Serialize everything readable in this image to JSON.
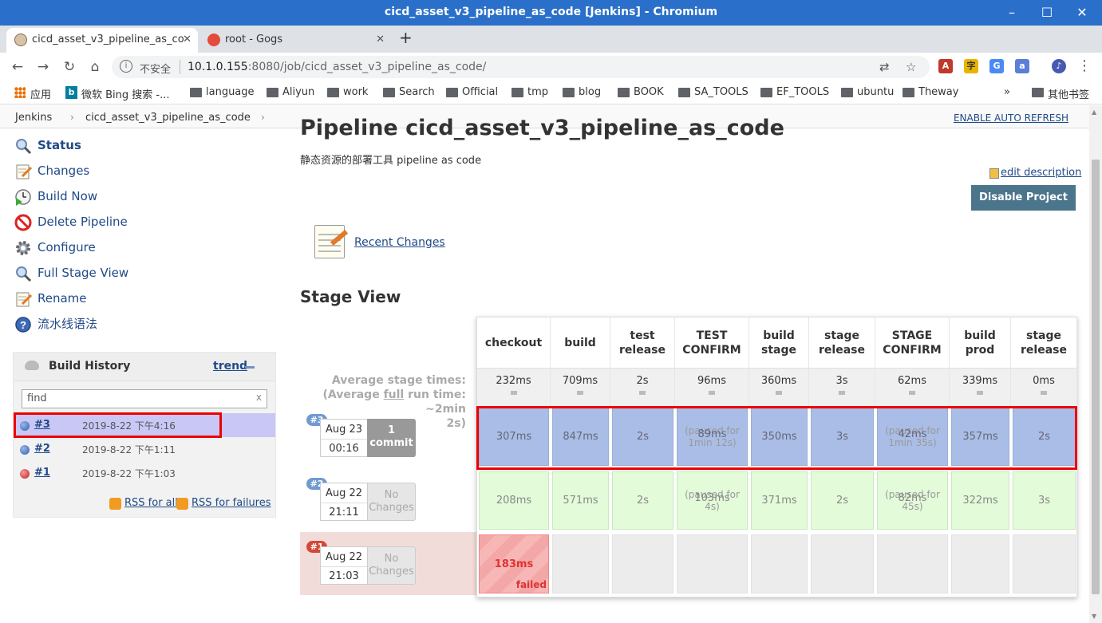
{
  "window": {
    "title": "cicd_asset_v3_pipeline_as_code [Jenkins] - Chromium"
  },
  "tabs": [
    {
      "label": "cicd_asset_v3_pipeline_as_co",
      "active": true
    },
    {
      "label": "root - Gogs",
      "active": false
    }
  ],
  "address": {
    "security_label": "不安全",
    "url_host": "10.1.0.155",
    "url_rest": ":8080/job/cicd_asset_v3_pipeline_as_code/"
  },
  "bookmarks": [
    {
      "label": "应用",
      "kind": "apps"
    },
    {
      "label": "微软 Bing 搜索 -...",
      "kind": "bing"
    },
    {
      "label": "language",
      "kind": "folder"
    },
    {
      "label": "Aliyun",
      "kind": "folder"
    },
    {
      "label": "work",
      "kind": "folder"
    },
    {
      "label": "Search",
      "kind": "folder"
    },
    {
      "label": "Official",
      "kind": "folder"
    },
    {
      "label": "tmp",
      "kind": "folder"
    },
    {
      "label": "blog",
      "kind": "folder"
    },
    {
      "label": "BOOK",
      "kind": "folder"
    },
    {
      "label": "SA_TOOLS",
      "kind": "folder"
    },
    {
      "label": "EF_TOOLS",
      "kind": "folder"
    },
    {
      "label": "ubuntu",
      "kind": "folder"
    },
    {
      "label": "Theway",
      "kind": "folder"
    },
    {
      "label": "其他书签",
      "kind": "folder"
    }
  ],
  "bookmarks_overflow": "»",
  "breadcrumb": {
    "root": "Jenkins",
    "job": "cicd_asset_v3_pipeline_as_code",
    "auto_refresh": "ENABLE AUTO REFRESH"
  },
  "side_tasks": [
    {
      "label": "Status",
      "icon": "magnifier-icon"
    },
    {
      "label": "Changes",
      "icon": "notepad-icon"
    },
    {
      "label": "Build Now",
      "icon": "clock-play-icon"
    },
    {
      "label": "Delete Pipeline",
      "icon": "no-entry-icon"
    },
    {
      "label": "Configure",
      "icon": "gear-icon"
    },
    {
      "label": "Full Stage View",
      "icon": "magnifier-icon"
    },
    {
      "label": "Rename",
      "icon": "notepad-icon"
    },
    {
      "label": "流水线语法",
      "icon": "help-icon"
    }
  ],
  "build_history": {
    "title": "Build History",
    "trend": "trend",
    "search_placeholder": "find",
    "search_clear": "x",
    "builds": [
      {
        "number": "#3",
        "date": "2019-8-22 下午4:16",
        "status": "success"
      },
      {
        "number": "#2",
        "date": "2019-8-22 下午1:11",
        "status": "success"
      },
      {
        "number": "#1",
        "date": "2019-8-22 下午1:03",
        "status": "failed"
      }
    ],
    "rss_all": "RSS for all",
    "rss_failures": "RSS for failures"
  },
  "main": {
    "title": "Pipeline cicd_asset_v3_pipeline_as_code",
    "description": "静态资源的部署工具 pipeline as code",
    "edit_description": "edit description",
    "disable_button": "Disable Project",
    "recent_changes": "Recent Changes",
    "stage_view_title": "Stage View"
  },
  "stage_view": {
    "avg_label_line1": "Average stage times:",
    "avg_label_pre": "(Average ",
    "avg_label_link": "full",
    "avg_label_post": " run time: ~2min",
    "avg_label_line3": "2s)",
    "stages": [
      {
        "name": "checkout",
        "avg": "232ms"
      },
      {
        "name": "build",
        "avg": "709ms"
      },
      {
        "name": "test release",
        "avg": "2s"
      },
      {
        "name": "TEST CONFIRM",
        "avg": "96ms"
      },
      {
        "name": "build stage",
        "avg": "360ms"
      },
      {
        "name": "stage release",
        "avg": "3s"
      },
      {
        "name": "STAGE CONFIRM",
        "avg": "62ms"
      },
      {
        "name": "build prod",
        "avg": "339ms"
      },
      {
        "name": "stage release",
        "avg": "0ms"
      }
    ],
    "runs": [
      {
        "badge": "#3",
        "date": "Aug 23",
        "time": "00:16",
        "changes_count": "1",
        "changes_label": "commit",
        "state": "blue",
        "cells": [
          {
            "value": "307ms"
          },
          {
            "value": "847ms"
          },
          {
            "value": "2s"
          },
          {
            "value": "89ms",
            "note": "(paused for 1min 12s)"
          },
          {
            "value": "350ms"
          },
          {
            "value": "3s"
          },
          {
            "value": "42ms",
            "note": "(paused for 1min 35s)"
          },
          {
            "value": "357ms"
          },
          {
            "value": "2s"
          }
        ]
      },
      {
        "badge": "#2",
        "date": "Aug 22",
        "time": "21:11",
        "changes_count": "No",
        "changes_label": "Changes",
        "state": "green",
        "cells": [
          {
            "value": "208ms"
          },
          {
            "value": "571ms"
          },
          {
            "value": "2s"
          },
          {
            "value": "103ms",
            "note": "(paused for 4s)"
          },
          {
            "value": "371ms"
          },
          {
            "value": "2s"
          },
          {
            "value": "82ms",
            "note": "(paused for 45s)"
          },
          {
            "value": "322ms"
          },
          {
            "value": "3s"
          }
        ]
      },
      {
        "badge": "#1",
        "date": "Aug 22",
        "time": "21:03",
        "changes_count": "No",
        "changes_label": "Changes",
        "state": "failed",
        "cells": [
          {
            "value": "183ms",
            "status": "failed"
          }
        ]
      }
    ]
  },
  "colors": {
    "titlebar": "#2a6fc9",
    "link": "#204a87",
    "disable_button": "#4b758b",
    "highlight_box": "#ee0000",
    "run_blue": "#a9bde6",
    "run_green": "#e3fbd9",
    "run_failed": "#f4a7a7"
  }
}
